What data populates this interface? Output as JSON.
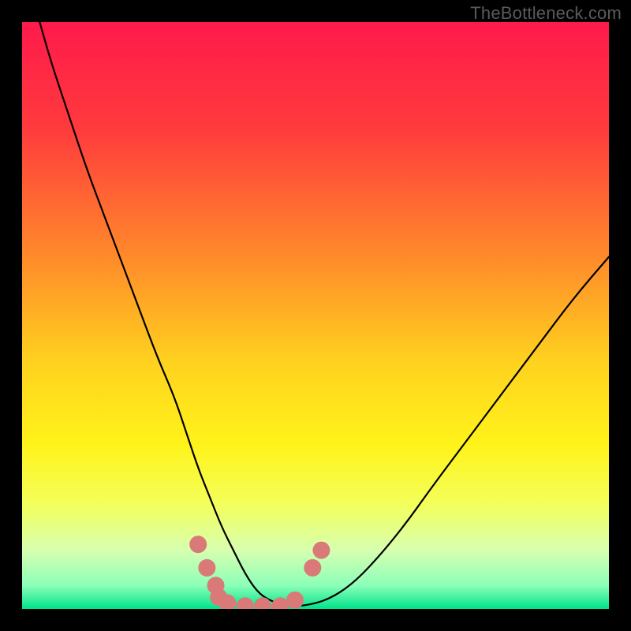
{
  "attribution": "TheBottleneck.com",
  "chart_data": {
    "type": "line",
    "title": "",
    "xlabel": "",
    "ylabel": "",
    "xlim": [
      0,
      100
    ],
    "ylim": [
      0,
      100
    ],
    "background_gradient": {
      "stops": [
        {
          "offset": 0.0,
          "color": "#ff1a4b"
        },
        {
          "offset": 0.18,
          "color": "#ff3a3d"
        },
        {
          "offset": 0.4,
          "color": "#ff8a2a"
        },
        {
          "offset": 0.58,
          "color": "#ffd21f"
        },
        {
          "offset": 0.72,
          "color": "#fff31a"
        },
        {
          "offset": 0.82,
          "color": "#f4ff5a"
        },
        {
          "offset": 0.9,
          "color": "#d7ffb0"
        },
        {
          "offset": 0.96,
          "color": "#8cffb8"
        },
        {
          "offset": 1.0,
          "color": "#00e38a"
        }
      ]
    },
    "series": [
      {
        "name": "bottleneck-curve",
        "color": "#000000",
        "width": 2.2,
        "x": [
          3,
          5,
          8,
          11,
          14,
          17,
          20,
          23,
          26,
          28,
          30,
          32,
          34,
          36,
          38,
          40,
          42,
          45,
          48,
          52,
          56,
          60,
          65,
          70,
          76,
          82,
          88,
          94,
          100
        ],
        "y": [
          100,
          93,
          84,
          75,
          67,
          59,
          51,
          43,
          36,
          30,
          24,
          19,
          14,
          10,
          6,
          3,
          1.5,
          0.5,
          0.5,
          1.5,
          4,
          8,
          14,
          21,
          29,
          37,
          45,
          53,
          60
        ]
      }
    ],
    "markers": {
      "name": "trough-markers",
      "color": "#d97a78",
      "radius": 11,
      "points": [
        {
          "x": 30.0,
          "y": 11.0
        },
        {
          "x": 31.5,
          "y": 7.0
        },
        {
          "x": 33.0,
          "y": 4.0
        },
        {
          "x": 33.5,
          "y": 2.0
        },
        {
          "x": 35.0,
          "y": 1.0
        },
        {
          "x": 38.0,
          "y": 0.5
        },
        {
          "x": 41.0,
          "y": 0.5
        },
        {
          "x": 44.0,
          "y": 0.5
        },
        {
          "x": 46.5,
          "y": 1.5
        },
        {
          "x": 49.5,
          "y": 7.0
        },
        {
          "x": 51.0,
          "y": 10.0
        }
      ]
    }
  }
}
